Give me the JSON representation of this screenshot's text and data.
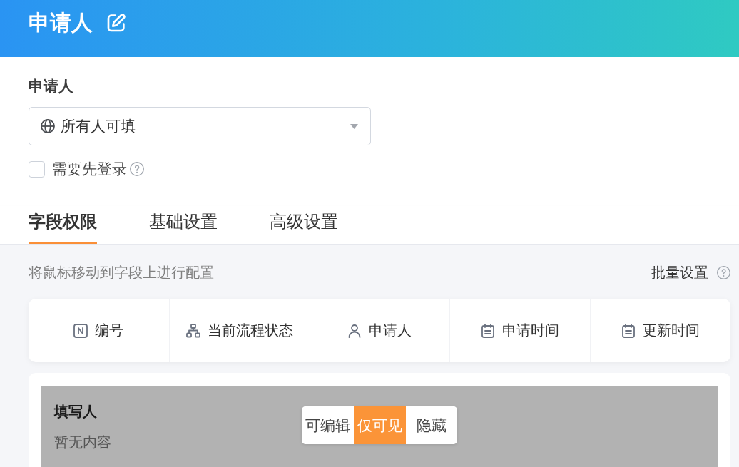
{
  "header": {
    "title": "申请人"
  },
  "applicant": {
    "label": "申请人",
    "select": {
      "value": "所有人可填"
    },
    "login_required": {
      "label": "需要先登录",
      "checked": false
    }
  },
  "tabs": [
    {
      "label": "字段权限",
      "selected": true
    },
    {
      "label": "基础设置",
      "selected": false
    },
    {
      "label": "高级设置",
      "selected": false
    }
  ],
  "toolbar": {
    "hint": "将鼠标移动到字段上进行配置",
    "batch_settings": "批量设置"
  },
  "fields": [
    {
      "label": "编号",
      "kind": "number"
    },
    {
      "label": "当前流程状态",
      "kind": "flow"
    },
    {
      "label": "申请人",
      "kind": "person"
    },
    {
      "label": "申请时间",
      "kind": "date"
    },
    {
      "label": "更新时间",
      "kind": "date"
    }
  ],
  "field_card": {
    "title": "填写人",
    "empty_text": "暂无内容",
    "options": [
      {
        "label": "可编辑",
        "selected": false
      },
      {
        "label": "仅可见",
        "selected": true
      },
      {
        "label": "隐藏",
        "selected": false
      }
    ]
  }
}
